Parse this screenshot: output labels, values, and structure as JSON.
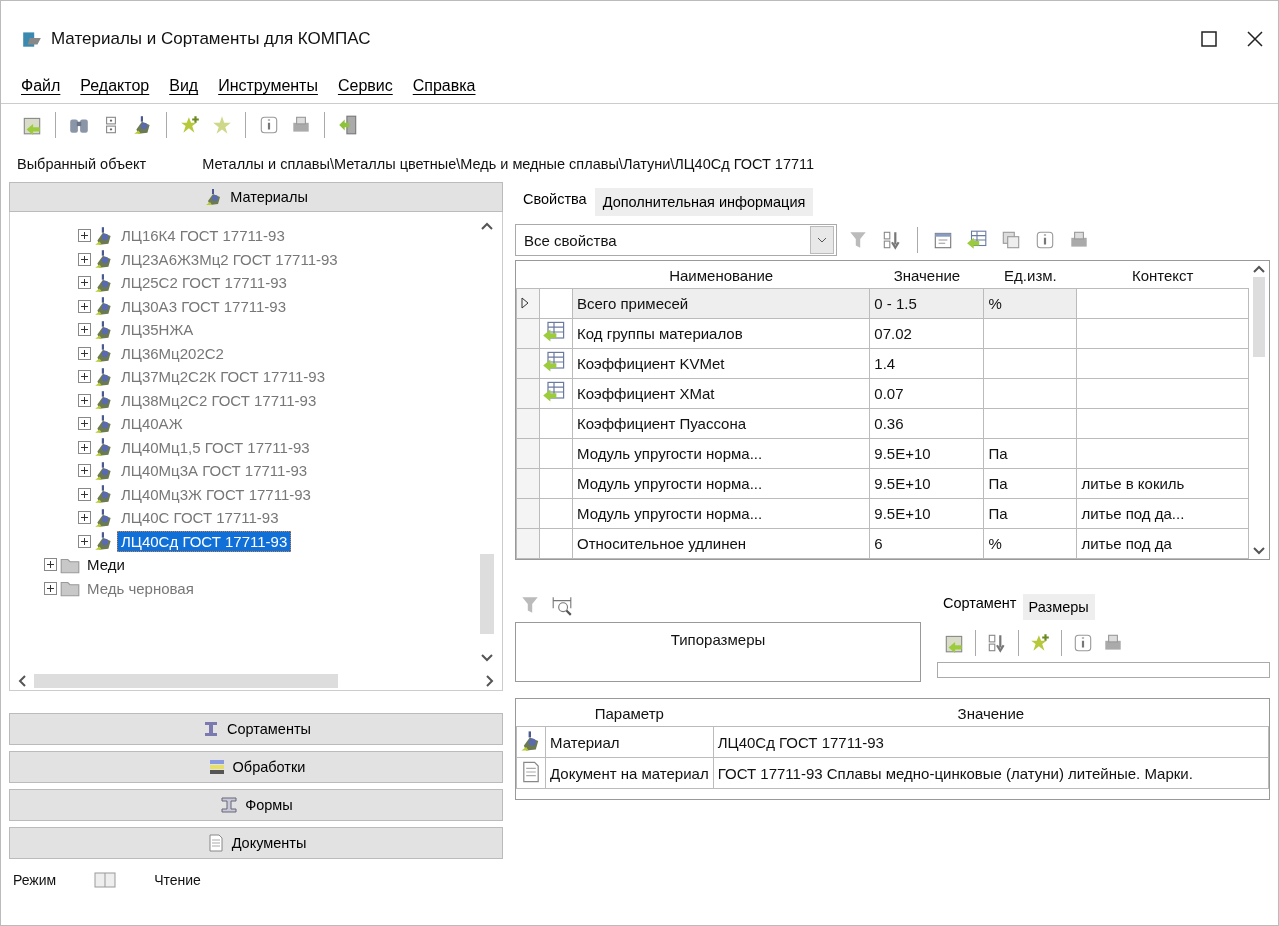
{
  "window": {
    "title": "Материалы и Сортаменты для КОМПАС"
  },
  "menu": [
    {
      "label": "Файл"
    },
    {
      "label": "Редактор"
    },
    {
      "label": "Вид"
    },
    {
      "label": "Инструменты"
    },
    {
      "label": "Сервис"
    },
    {
      "label": "Справка"
    }
  ],
  "toolbar": [
    {
      "kind": "open"
    },
    {
      "kind": "sep"
    },
    {
      "kind": "binoculars"
    },
    {
      "kind": "list"
    },
    {
      "kind": "material"
    },
    {
      "kind": "sep"
    },
    {
      "kind": "star-plus"
    },
    {
      "kind": "star"
    },
    {
      "kind": "sep"
    },
    {
      "kind": "info"
    },
    {
      "kind": "print"
    },
    {
      "kind": "sep"
    },
    {
      "kind": "exit"
    }
  ],
  "selected_object": {
    "label": "Выбранный объект",
    "path": "Металлы и сплавы\\Металлы цветные\\Медь и медные сплавы\\Латуни\\ЛЦ40Сд ГОСТ 17711"
  },
  "materials_header": {
    "label": "Материалы"
  },
  "tree": [
    {
      "label": "ЛЦ16К4 ГОСТ 17711-93",
      "kind": "alloy",
      "dimmed": true,
      "selected": false
    },
    {
      "label": "ЛЦ23А6Ж3Мц2 ГОСТ 17711-93",
      "kind": "alloy",
      "dimmed": true,
      "selected": false
    },
    {
      "label": "ЛЦ25С2 ГОСТ 17711-93",
      "kind": "alloy",
      "dimmed": true,
      "selected": false
    },
    {
      "label": "ЛЦ30А3 ГОСТ 17711-93",
      "kind": "alloy",
      "dimmed": true,
      "selected": false
    },
    {
      "label": "ЛЦ35НЖА",
      "kind": "alloy",
      "dimmed": true,
      "selected": false
    },
    {
      "label": "ЛЦ36Мц202С2",
      "kind": "alloy",
      "dimmed": true,
      "selected": false
    },
    {
      "label": "ЛЦ37Мц2С2К ГОСТ 17711-93",
      "kind": "alloy",
      "dimmed": true,
      "selected": false
    },
    {
      "label": "ЛЦ38Мц2С2 ГОСТ 17711-93",
      "kind": "alloy",
      "dimmed": true,
      "selected": false
    },
    {
      "label": "ЛЦ40АЖ",
      "kind": "alloy",
      "dimmed": true,
      "selected": false
    },
    {
      "label": "ЛЦ40Мц1,5 ГОСТ 17711-93",
      "kind": "alloy",
      "dimmed": true,
      "selected": false
    },
    {
      "label": "ЛЦ40Мц3А ГОСТ 17711-93",
      "kind": "alloy",
      "dimmed": true,
      "selected": false
    },
    {
      "label": "ЛЦ40Мц3Ж ГОСТ 17711-93",
      "kind": "alloy",
      "dimmed": true,
      "selected": false
    },
    {
      "label": "ЛЦ40С ГОСТ 17711-93",
      "kind": "alloy",
      "dimmed": true,
      "selected": false
    },
    {
      "label": "ЛЦ40Сд ГОСТ 17711-93",
      "kind": "alloy",
      "dimmed": false,
      "selected": true
    },
    {
      "label": "Меди",
      "kind": "folder",
      "dimmed": false,
      "selected": false
    },
    {
      "label": "Медь черновая",
      "kind": "folder",
      "dimmed": true,
      "selected": false
    }
  ],
  "nav_buttons": [
    {
      "label": "Сортаменты",
      "kind": "beam"
    },
    {
      "label": "Обработки",
      "kind": "layers"
    },
    {
      "label": "Формы",
      "kind": "ibeam"
    },
    {
      "label": "Документы",
      "kind": "document"
    }
  ],
  "status_bar": {
    "mode_label": "Режим",
    "mode_value": "Чтение"
  },
  "tabs": [
    {
      "label": "Свойства",
      "selected": true
    },
    {
      "label": "Дополнительная информация",
      "selected": false
    }
  ],
  "filter": {
    "value": "Все свойства"
  },
  "props_toolbar": [
    {
      "kind": "funnel"
    },
    {
      "kind": "sort"
    },
    {
      "kind": "sep"
    },
    {
      "kind": "edit"
    },
    {
      "kind": "table"
    },
    {
      "kind": "copy"
    },
    {
      "kind": "info"
    },
    {
      "kind": "print"
    }
  ],
  "properties": {
    "columns": [
      "Наименование",
      "Значение",
      "Ед.изм.",
      "Контекст"
    ],
    "rows": [
      {
        "kind": "plain",
        "selected": true,
        "cells": [
          "Всего примесей",
          "0 - 1.5",
          "%",
          ""
        ]
      },
      {
        "kind": "group",
        "selected": false,
        "cells": [
          "Код группы материалов",
          "07.02",
          "",
          ""
        ]
      },
      {
        "kind": "group",
        "selected": false,
        "cells": [
          "Коэффициент KVMet",
          "1.4",
          "",
          ""
        ]
      },
      {
        "kind": "group",
        "selected": false,
        "cells": [
          "Коэффициент XMat",
          "0.07",
          "",
          ""
        ]
      },
      {
        "kind": "plain",
        "selected": false,
        "cells": [
          "Коэффициент Пуассона",
          "0.36",
          "",
          ""
        ]
      },
      {
        "kind": "plain",
        "selected": false,
        "cells": [
          "Модуль упругости норма...",
          "9.5E+10",
          "Па",
          ""
        ]
      },
      {
        "kind": "plain",
        "selected": false,
        "cells": [
          "Модуль упругости норма...",
          "9.5E+10",
          "Па",
          "литье в кокиль"
        ]
      },
      {
        "kind": "plain",
        "selected": false,
        "cells": [
          "Модуль упругости норма...",
          "9.5E+10",
          "Па",
          "литье под да..."
        ]
      },
      {
        "kind": "plain",
        "selected": false,
        "cells": [
          "Относительное удлинен",
          "6",
          "%",
          "литье под да"
        ]
      }
    ]
  },
  "sizes": {
    "label": "Типоразмеры"
  },
  "lower_tabs": [
    {
      "label": "Сортамент",
      "selected": true
    },
    {
      "label": "Размеры",
      "selected": false
    }
  ],
  "sort_toolbar": [
    {
      "kind": "open"
    },
    {
      "kind": "sep"
    },
    {
      "kind": "sort"
    },
    {
      "kind": "sep"
    },
    {
      "kind": "star-plus"
    },
    {
      "kind": "sep"
    },
    {
      "kind": "info"
    },
    {
      "kind": "print"
    }
  ],
  "params": {
    "columns": [
      "Параметр",
      "Значение"
    ],
    "rows": [
      {
        "kind": "material",
        "cells": [
          "Материал",
          "ЛЦ40Сд ГОСТ 17711-93"
        ]
      },
      {
        "kind": "document",
        "cells": [
          "Документ на материал",
          "ГОСТ 17711-93 Сплавы медно-цинковые (латуни) литейные. Марки."
        ]
      }
    ]
  }
}
